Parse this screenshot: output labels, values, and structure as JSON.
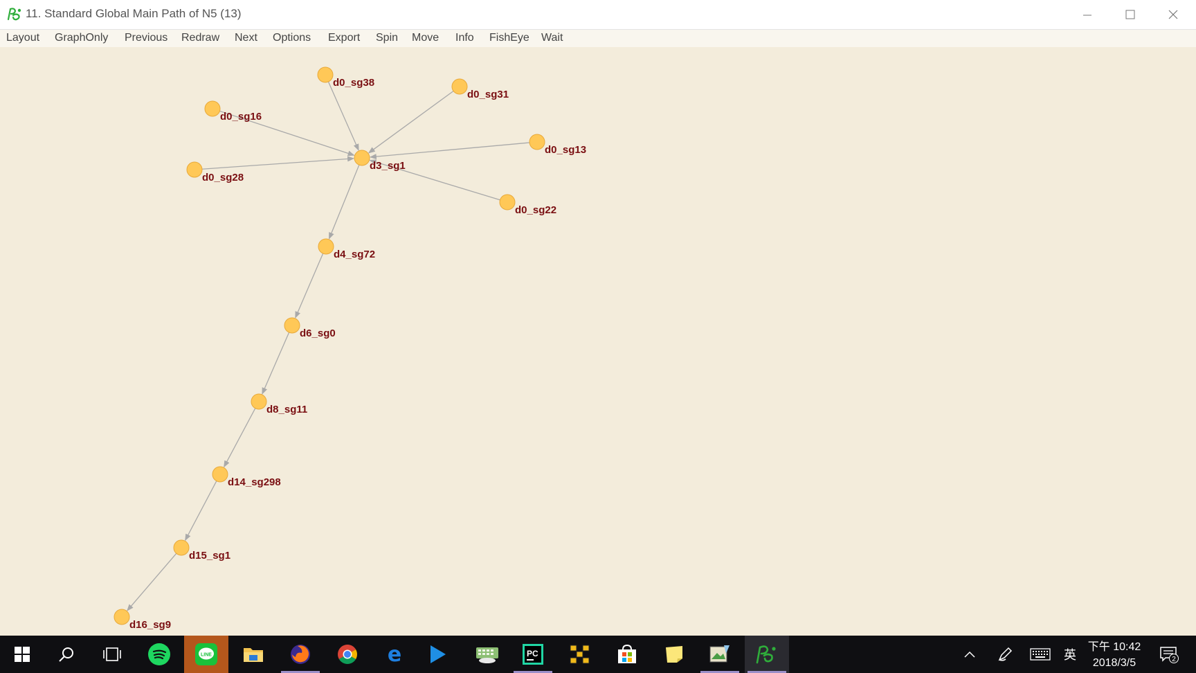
{
  "window": {
    "title": "11. Standard Global Main Path of N5 (13)",
    "icon": "pajek-logo-icon",
    "controls": [
      "minimize-icon",
      "maximize-icon",
      "close-icon"
    ]
  },
  "menu": {
    "items": [
      "Layout",
      "GraphOnly",
      "Previous",
      "Redraw",
      "Next",
      "Options",
      "Export",
      "Spin",
      "Move",
      "Info",
      "FishEye",
      "Wait"
    ]
  },
  "graph": {
    "background_color": "#f3ecdb",
    "node_color": "#ffc857",
    "label_color": "#7a0f12",
    "edge_color": "#a9a9a9",
    "nodes": [
      {
        "id": "d0_sg38",
        "label": "d0_sg38"
      },
      {
        "id": "d0_sg31",
        "label": "d0_sg31"
      },
      {
        "id": "d0_sg16",
        "label": "d0_sg16"
      },
      {
        "id": "d0_sg13",
        "label": "d0_sg13"
      },
      {
        "id": "d3_sg1",
        "label": "d3_sg1"
      },
      {
        "id": "d0_sg28",
        "label": "d0_sg28"
      },
      {
        "id": "d0_sg22",
        "label": "d0_sg22"
      },
      {
        "id": "d4_sg72",
        "label": "d4_sg72"
      },
      {
        "id": "d6_sg0",
        "label": "d6_sg0"
      },
      {
        "id": "d8_sg11",
        "label": "d8_sg11"
      },
      {
        "id": "d14_sg298",
        "label": "d14_sg298"
      },
      {
        "id": "d15_sg1",
        "label": "d15_sg1"
      },
      {
        "id": "d16_sg9",
        "label": "d16_sg9"
      }
    ],
    "edges": [
      {
        "from": "d0_sg38",
        "to": "d3_sg1"
      },
      {
        "from": "d0_sg31",
        "to": "d3_sg1"
      },
      {
        "from": "d0_sg16",
        "to": "d3_sg1"
      },
      {
        "from": "d0_sg13",
        "to": "d3_sg1"
      },
      {
        "from": "d0_sg28",
        "to": "d3_sg1"
      },
      {
        "from": "d0_sg22",
        "to": "d3_sg1"
      },
      {
        "from": "d3_sg1",
        "to": "d4_sg72"
      },
      {
        "from": "d4_sg72",
        "to": "d6_sg0"
      },
      {
        "from": "d6_sg0",
        "to": "d8_sg11"
      },
      {
        "from": "d8_sg11",
        "to": "d14_sg298"
      },
      {
        "from": "d14_sg298",
        "to": "d15_sg1"
      },
      {
        "from": "d15_sg1",
        "to": "d16_sg9"
      }
    ]
  },
  "taskbar": {
    "apps": [
      {
        "name": "start",
        "icon": "windows-start-icon"
      },
      {
        "name": "search",
        "icon": "search-icon"
      },
      {
        "name": "task-view",
        "icon": "task-view-icon"
      },
      {
        "name": "spotify",
        "icon": "spotify-icon"
      },
      {
        "name": "line",
        "icon": "line-app-icon"
      },
      {
        "name": "file-explorer",
        "icon": "folder-icon"
      },
      {
        "name": "firefox",
        "icon": "firefox-icon"
      },
      {
        "name": "chrome",
        "icon": "chrome-icon"
      },
      {
        "name": "edge",
        "icon": "edge-icon"
      },
      {
        "name": "media-player",
        "icon": "play-icon"
      },
      {
        "name": "keyboard-app",
        "icon": "keyboard-cloud-icon"
      },
      {
        "name": "pycharm",
        "icon": "pycharm-icon"
      },
      {
        "name": "network-app",
        "icon": "network-diagram-icon"
      },
      {
        "name": "store",
        "icon": "store-icon"
      },
      {
        "name": "sticky-notes",
        "icon": "sticky-note-icon"
      },
      {
        "name": "image-viewer",
        "icon": "image-icon"
      },
      {
        "name": "pajek",
        "icon": "pajek-icon"
      }
    ],
    "tray": {
      "icons": [
        "chevron-up-icon",
        "pen-icon",
        "keyboard-icon"
      ],
      "ime": "英",
      "time": "下午 10:42",
      "date": "2018/3/5",
      "notification_count": "2"
    }
  }
}
